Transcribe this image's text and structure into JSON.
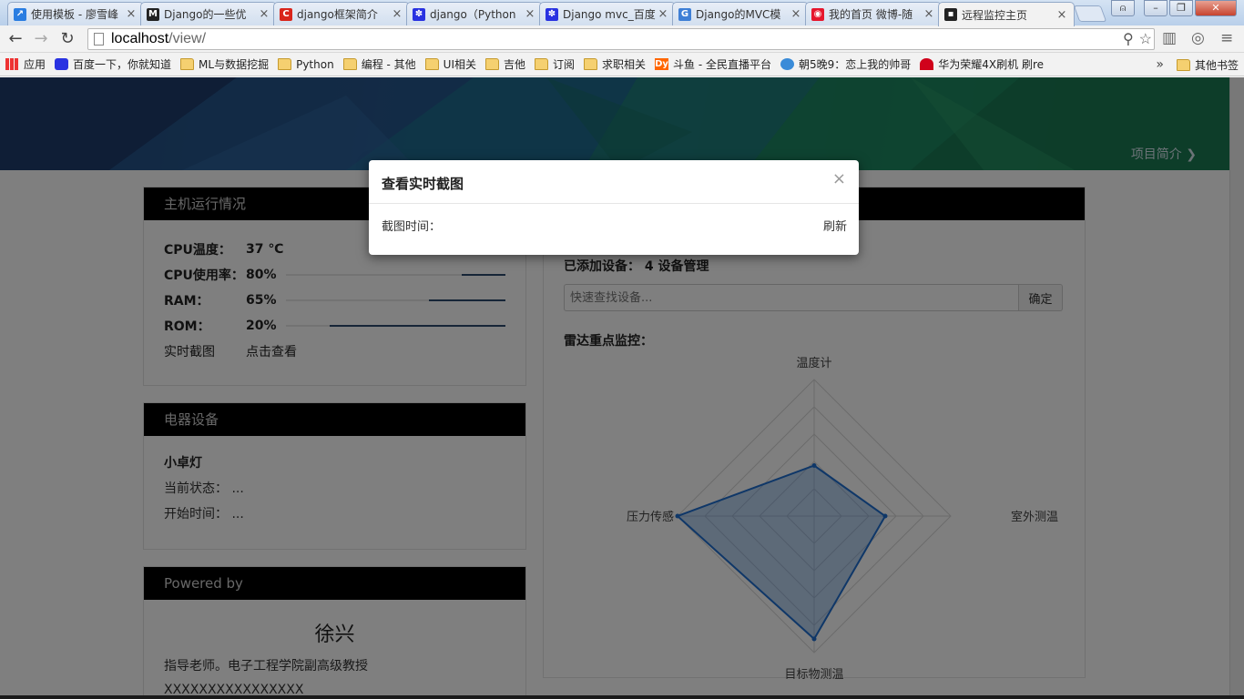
{
  "browser": {
    "tabs": [
      {
        "label": "使用模板 - 廖雪峰",
        "favicon_color": "#2a7de1",
        "favicon": "↗"
      },
      {
        "label": "Django的一些优",
        "favicon_color": "#222",
        "favicon": "M"
      },
      {
        "label": "django框架简介",
        "favicon_color": "#d9261c",
        "favicon": "C"
      },
      {
        "label": "django（Python",
        "favicon_color": "#2932e1",
        "favicon": "✽"
      },
      {
        "label": "Django mvc_百度",
        "favicon_color": "#2932e1",
        "favicon": "✽"
      },
      {
        "label": "Django的MVC模",
        "favicon_color": "#3e7fd6",
        "favicon": "G"
      },
      {
        "label": "我的首页 微博-随",
        "favicon_color": "#e6162d",
        "favicon": "◉"
      },
      {
        "label": "远程监控主页",
        "favicon_color": "#222",
        "favicon": "▪"
      }
    ],
    "url_host": "localhost",
    "url_path": "/view/",
    "bookmarks": [
      {
        "label": "应用",
        "icon": "apps"
      },
      {
        "label": "百度一下，你就知道",
        "icon": "baidu"
      },
      {
        "label": "ML与数据挖掘",
        "icon": "folder"
      },
      {
        "label": "Python",
        "icon": "folder"
      },
      {
        "label": "编程 - 其他",
        "icon": "folder"
      },
      {
        "label": "UI相关",
        "icon": "folder"
      },
      {
        "label": "吉他",
        "icon": "folder"
      },
      {
        "label": "订阅",
        "icon": "folder"
      },
      {
        "label": "求职相关",
        "icon": "folder"
      },
      {
        "label": "斗鱼 - 全民直播平台",
        "icon": "douyu"
      },
      {
        "label": "朝5晚9：恋上我的帅哥",
        "icon": "dayu"
      },
      {
        "label": "华为荣耀4X刷机 刷re",
        "icon": "huawei"
      }
    ],
    "more_bookmarks": "»",
    "other_bookmarks": "其他书签"
  },
  "banner": {
    "link": "项目简介 ❯"
  },
  "host_panel": {
    "title": "主机运行情况",
    "rows": [
      {
        "label": "CPU温度：",
        "value": "37 ℃"
      },
      {
        "label": "CPU使用率：",
        "value": "80%",
        "fraction": 0.2
      },
      {
        "label": "RAM：",
        "value": "65%",
        "fraction": 0.35
      },
      {
        "label": "ROM：",
        "value": "20%",
        "fraction": 0.8
      }
    ],
    "screenshot_label": "实时截图",
    "screenshot_link": "点击查看"
  },
  "device_panel": {
    "title": "电器设备",
    "device_name": "小卓灯",
    "status_label": "当前状态：",
    "status_value": "...",
    "start_label": "开始时间：",
    "start_value": "..."
  },
  "powered_panel": {
    "title": "Powered by",
    "author": "徐兴",
    "desc": "指导老师。电子工程学院副高级教授",
    "extra": "XXXXXXXXXXXXXXXX"
  },
  "right_panel": {
    "added_label": "已添加设备：",
    "added_count": "4",
    "manage_label": "设备管理",
    "search_placeholder": "快速查找设备...",
    "search_button": "确定",
    "radar_title": "雷达重点监控："
  },
  "chart_data": {
    "type": "radar",
    "indicators": [
      "温度计",
      "室外测温",
      "目标物测温",
      "压力传感"
    ],
    "values": [
      0.37,
      0.52,
      0.9,
      1.0
    ],
    "max": 1,
    "series_color": "#1f6fd0"
  },
  "modal": {
    "title": "查看实时截图",
    "close": "×",
    "time_label": "截图时间：",
    "refresh": "刷新"
  }
}
